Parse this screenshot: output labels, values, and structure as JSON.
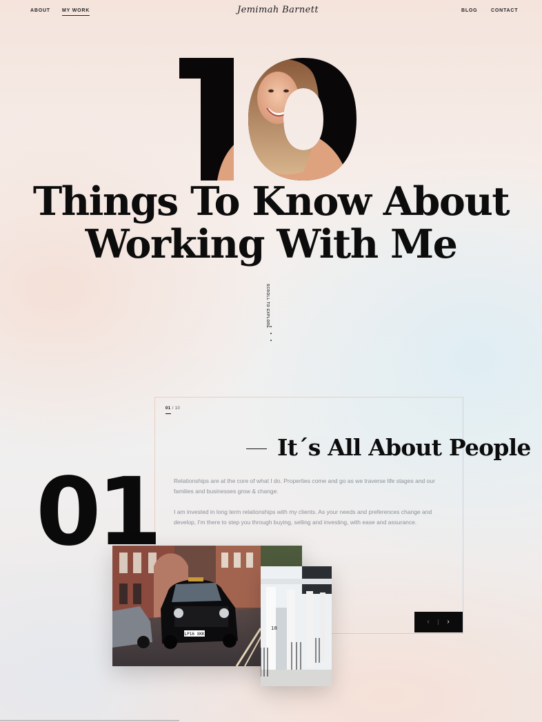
{
  "nav": {
    "about": "ABOUT",
    "my_work": "MY WORK",
    "blog": "BLOG",
    "contact": "CONTACT",
    "logo": "Jemimah Barnett"
  },
  "hero": {
    "number": "10",
    "title_line1": "Things To Know About",
    "title_line2": "Working With Me",
    "scroll_label": "SCROLL TO EXPLORE"
  },
  "card": {
    "counter_current": "01",
    "counter_total": "/ 10",
    "heading": "It´s All About People",
    "index": "01",
    "paragraph_1": "Relationships are at the core of what I do. Properties come and go as we traverse life stages and our families and businesses grow & change.",
    "paragraph_2": "I am invested in long term relationships with my clients. As your needs and preferences change and develop, I'm there to step you through buying, selling and investing, with ease and assurance.",
    "taxi_plate": "LP16 XKK",
    "house_number": "18"
  },
  "controls": {
    "prev_icon": "chevron-left-icon",
    "next_icon": "chevron-right-icon",
    "prev_glyph": "‹",
    "next_glyph": "›"
  }
}
